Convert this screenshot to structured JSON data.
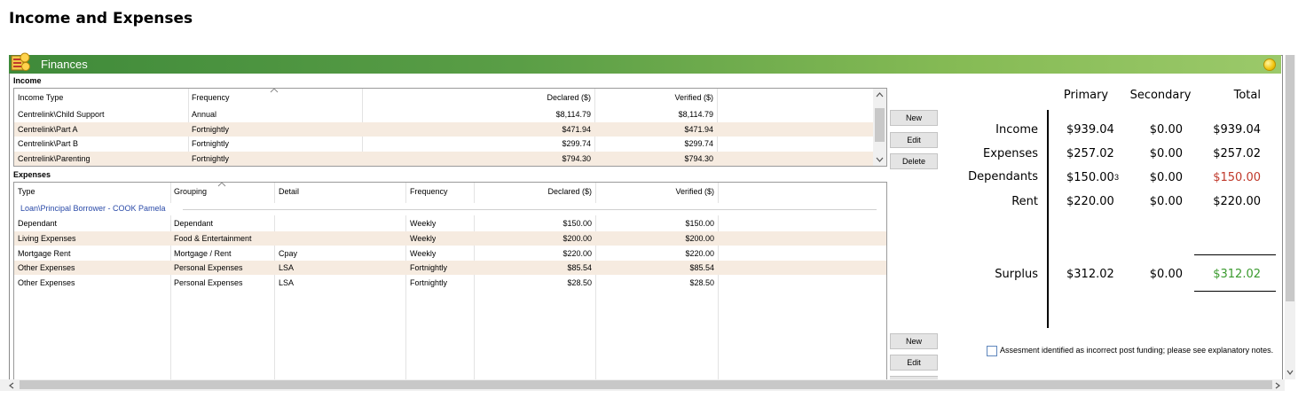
{
  "page_title": "Income and Expenses",
  "panel": {
    "title": "Finances"
  },
  "income": {
    "section_label": "Income",
    "headers": [
      "Income Type",
      "Frequency",
      "Declared ($)",
      "Verified ($)"
    ],
    "rows": [
      {
        "type": "Centrelink\\Child Support",
        "frequency": "Annual",
        "declared": "$8,114.79",
        "verified": "$8,114.79"
      },
      {
        "type": "Centrelink\\Part A",
        "frequency": "Fortnightly",
        "declared": "$471.94",
        "verified": "$471.94"
      },
      {
        "type": "Centrelink\\Part B",
        "frequency": "Fortnightly",
        "declared": "$299.74",
        "verified": "$299.74"
      },
      {
        "type": "Centrelink\\Parenting",
        "frequency": "Fortnightly",
        "declared": "$794.30",
        "verified": "$794.30"
      }
    ],
    "buttons": {
      "new": "New",
      "edit": "Edit",
      "delete": "Delete"
    }
  },
  "expenses": {
    "section_label": "Expenses",
    "headers": [
      "Type",
      "Grouping",
      "Detail",
      "Frequency",
      "Declared ($)",
      "Verified ($)"
    ],
    "group_label": "Loan\\Principal Borrower - COOK Pamela",
    "rows": [
      {
        "type": "Dependant",
        "grouping": "Dependant",
        "detail": "",
        "frequency": "Weekly",
        "declared": "$150.00",
        "verified": "$150.00"
      },
      {
        "type": "Living Expenses",
        "grouping": "Food & Entertainment",
        "detail": "",
        "frequency": "Weekly",
        "declared": "$200.00",
        "verified": "$200.00"
      },
      {
        "type": "Mortgage Rent",
        "grouping": "Mortgage / Rent",
        "detail": "Cpay",
        "frequency": "Weekly",
        "declared": "$220.00",
        "verified": "$220.00"
      },
      {
        "type": "Other Expenses",
        "grouping": "Personal Expenses",
        "detail": "LSA",
        "frequency": "Fortnightly",
        "declared": "$85.54",
        "verified": "$85.54"
      },
      {
        "type": "Other Expenses",
        "grouping": "Personal Expenses",
        "detail": "LSA",
        "frequency": "Fortnightly",
        "declared": "$28.50",
        "verified": "$28.50"
      }
    ],
    "buttons": {
      "new": "New",
      "edit": "Edit"
    }
  },
  "summary": {
    "headers": [
      "Primary",
      "Secondary",
      "Total"
    ],
    "rows": [
      {
        "label": "Income",
        "primary": "$939.04",
        "secondary": "$0.00",
        "total": "$939.04",
        "total_color": "#000000"
      },
      {
        "label": "Expenses",
        "primary": "$257.02",
        "secondary": "$0.00",
        "total": "$257.02",
        "total_color": "#000000"
      },
      {
        "label": "Dependants",
        "primary": "$150.00",
        "count": "3",
        "secondary": "$0.00",
        "total": "$150.00",
        "total_color": "#c0392b"
      },
      {
        "label": "Rent",
        "primary": "$220.00",
        "secondary": "$0.00",
        "total": "$220.00",
        "total_color": "#000000"
      }
    ],
    "surplus": {
      "label": "Surplus",
      "primary": "$312.02",
      "secondary": "$0.00",
      "total": "$312.02",
      "total_color": "#3a9a2e"
    },
    "note": "Assesment identified as incorrect post funding; please see explanatory notes.",
    "note_checked": false
  },
  "colors": {
    "titlebar_start": "#3f8a3a",
    "titlebar_end": "#9bc96a",
    "alt_row": "#f6ebe0",
    "group_label": "#2a4aa8",
    "negative": "#c0392b",
    "positive": "#3a9a2e"
  }
}
